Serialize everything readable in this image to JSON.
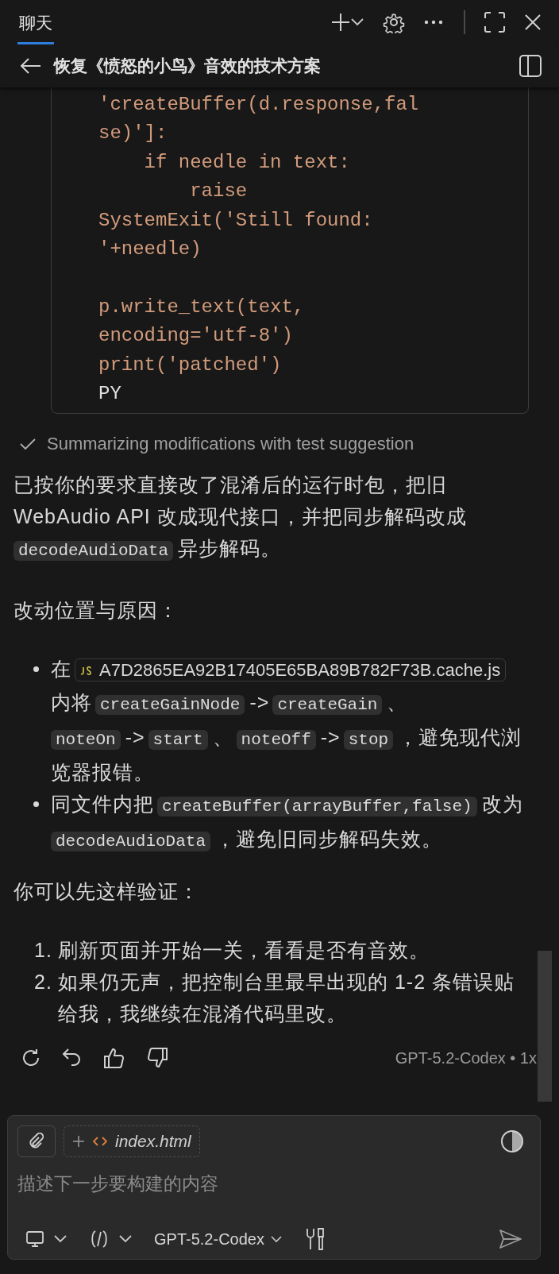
{
  "header": {
    "tabs": [
      {
        "label": "聊天",
        "selected": true
      }
    ]
  },
  "conversation": {
    "title": "恢复《愤怒的小鸟》音效的技术方案"
  },
  "code_block": {
    "line_groups": [
      {
        "lines": [
          {
            "text": "'createBuffer(d.response,fal",
            "kind": "string"
          },
          {
            "text": "se)']:",
            "kind": "string"
          },
          {
            "text": "    if needle in text:",
            "kind": "string"
          },
          {
            "text": "        raise",
            "kind": "string"
          },
          {
            "text": "SystemExit('Still found:",
            "kind": "string"
          },
          {
            "text": "'+needle)",
            "kind": "string"
          }
        ]
      },
      {
        "lines": [
          {
            "text": "p.write_text(text,",
            "kind": "string"
          },
          {
            "text": "encoding='utf-8')",
            "kind": "string"
          },
          {
            "text": "print('patched')",
            "kind": "string"
          },
          {
            "text": "PY",
            "kind": "plain"
          }
        ]
      }
    ]
  },
  "progress_step": {
    "text": "Summarizing modifications with test suggestion",
    "done": true
  },
  "message": [
    {
      "kind": "paragraph",
      "segments": [
        {
          "kind": "text",
          "text": "已按你的要求直接改了混淆后的运行时包，把旧 WebAudio API 改成现代接口，并把同步解码改成"
        },
        {
          "kind": "code",
          "text": "decodeAudioData"
        },
        {
          "kind": "text",
          "text": "异步解码。"
        }
      ]
    },
    {
      "kind": "paragraph",
      "segments": [
        {
          "kind": "text",
          "text": "改动位置与原因："
        }
      ]
    },
    {
      "kind": "bullets",
      "items": [
        {
          "segments": [
            {
              "kind": "text",
              "text": "在"
            },
            {
              "kind": "file",
              "text": "A7D2865EA92B17405E65BA89B782F73B.cache.js"
            },
            {
              "kind": "text",
              "text": "内将"
            },
            {
              "kind": "code",
              "text": "createGainNode"
            },
            {
              "kind": "text",
              "text": "->"
            },
            {
              "kind": "code",
              "text": "createGain"
            },
            {
              "kind": "text",
              "text": "、"
            },
            {
              "kind": "code",
              "text": "noteOn"
            },
            {
              "kind": "text",
              "text": "->"
            },
            {
              "kind": "code",
              "text": "start"
            },
            {
              "kind": "text",
              "text": "、"
            },
            {
              "kind": "code",
              "text": "noteOff"
            },
            {
              "kind": "text",
              "text": "->"
            },
            {
              "kind": "code",
              "text": "stop"
            },
            {
              "kind": "text",
              "text": "，避免现代浏览器报错。"
            }
          ]
        },
        {
          "segments": [
            {
              "kind": "text",
              "text": "同文件内把"
            },
            {
              "kind": "code",
              "text": "createBuffer(arrayBuffer,false)"
            },
            {
              "kind": "text",
              "text": "改为"
            },
            {
              "kind": "code",
              "text": "decodeAudioData"
            },
            {
              "kind": "text",
              "text": "，避免旧同步解码失效。"
            }
          ]
        }
      ]
    },
    {
      "kind": "paragraph",
      "segments": [
        {
          "kind": "text",
          "text": "你可以先这样验证："
        }
      ]
    },
    {
      "kind": "numbered",
      "items": [
        {
          "number": "1.",
          "text": "刷新页面并开始一关，看看是否有音效。"
        },
        {
          "number": "2.",
          "text": "如果仍无声，把控制台里最早出现的 1-2 条错误贴给我，我继续在混淆代码里改。"
        }
      ]
    }
  ],
  "feedback": {
    "model_info": "GPT-5.2-Codex • 1x"
  },
  "composer": {
    "attachment": {
      "name": "index.html"
    },
    "placeholder": "描述下一步要构建的内容",
    "model": "GPT-5.2-Codex"
  }
}
